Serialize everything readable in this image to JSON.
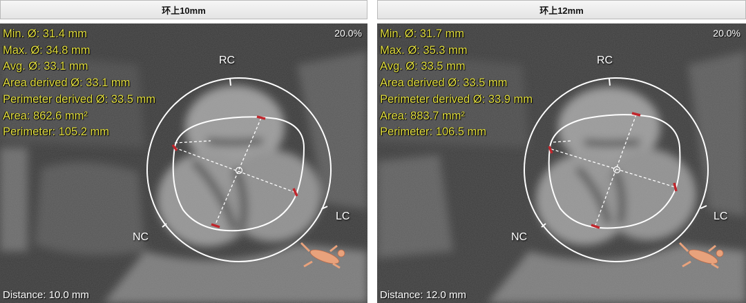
{
  "panels": [
    {
      "title": "环上10mm",
      "measurements": [
        "Min. Ø: 31.4 mm",
        "Max. Ø: 34.8 mm",
        "Avg. Ø: 33.1 mm",
        "Area derived Ø: 33.1 mm",
        "Perimeter derived Ø: 33.5 mm",
        "Area: 862.6 mm²",
        "Perimeter: 105.2 mm"
      ],
      "zoom": "20.0%",
      "distance": "Distance: 10.0 mm",
      "cusps": {
        "rc": "RC",
        "lc": "LC",
        "nc": "NC"
      }
    },
    {
      "title": "环上12mm",
      "measurements": [
        "Min. Ø: 31.7 mm",
        "Max. Ø: 35.3 mm",
        "Avg. Ø: 33.5 mm",
        "Area derived Ø: 33.5 mm",
        "Perimeter derived Ø: 33.9 mm",
        "Area: 883.7 mm²",
        "Perimeter: 106.5 mm"
      ],
      "zoom": "20.0%",
      "distance": "Distance: 12.0 mm",
      "cusps": {
        "rc": "RC",
        "lc": "LC",
        "nc": "NC"
      }
    }
  ],
  "colors": {
    "measurement_text": "#e3df3f",
    "overlay": "#ffffff",
    "diameter_marker": "#c0262c",
    "orientation_figure": "#e8a27c"
  },
  "icons": {
    "orientation": "human-body-orientation-icon"
  }
}
